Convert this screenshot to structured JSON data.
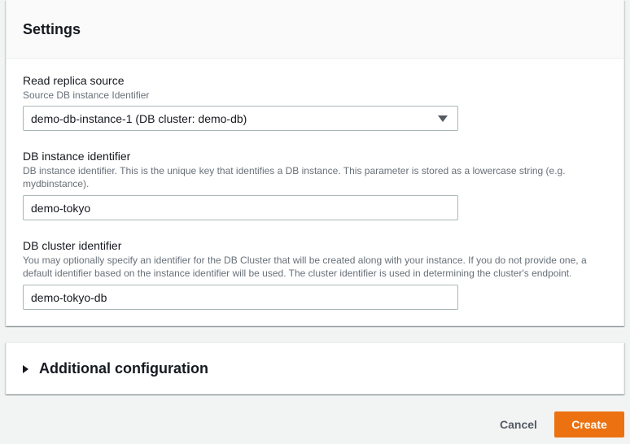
{
  "settings": {
    "title": "Settings",
    "read_replica_source": {
      "label": "Read replica source",
      "description": "Source DB instance Identifier",
      "selected_value": "demo-db-instance-1 (DB cluster: demo-db)"
    },
    "db_instance_identifier": {
      "label": "DB instance identifier",
      "description": "DB instance identifier. This is the unique key that identifies a DB instance. This parameter is stored as a lowercase string (e.g. mydbinstance).",
      "value": "demo-tokyo"
    },
    "db_cluster_identifier": {
      "label": "DB cluster identifier",
      "description": "You may optionally specify an identifier for the DB Cluster that will be created along with your instance. If you do not provide one, a default identifier based on the instance identifier will be used. The cluster identifier is used in determining the cluster's endpoint.",
      "value": "demo-tokyo-db"
    }
  },
  "additional_configuration": {
    "title": "Additional configuration",
    "icon": "caret-right-icon"
  },
  "footer": {
    "cancel_label": "Cancel",
    "create_label": "Create"
  },
  "colors": {
    "primary_button": "#ec7211",
    "background": "#f2f3f3",
    "text": "#16191f",
    "secondary_text": "#687078"
  }
}
